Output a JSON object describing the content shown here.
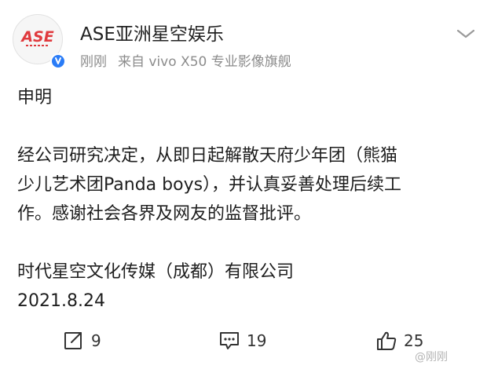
{
  "header": {
    "account_name": "ASE亚洲星空娱乐",
    "time": "刚刚",
    "source": "来自 vivo X50 专业影像旗舰",
    "avatar_logo_text": "ASE",
    "avatar_color": "#e03a3e",
    "verified_color": "#2a7cf7"
  },
  "post": {
    "title": "申明",
    "body_lines": [
      "经公司研究决定，从即日起解散天府少年团（熊猫",
      "少儿艺术团Panda boys），并认真妥善处理后续工",
      "作。感谢社会各界及网友的监督批评。"
    ],
    "signature": "时代星空文化传媒（成都）有限公司",
    "date": "2021.8.24"
  },
  "actions": {
    "repost_count": "9",
    "comment_count": "19",
    "like_count": "25",
    "repost_icon": "repost-icon",
    "comment_icon": "comment-icon",
    "like_icon": "like-icon"
  },
  "watermark": {
    "text": "@刚刚"
  }
}
